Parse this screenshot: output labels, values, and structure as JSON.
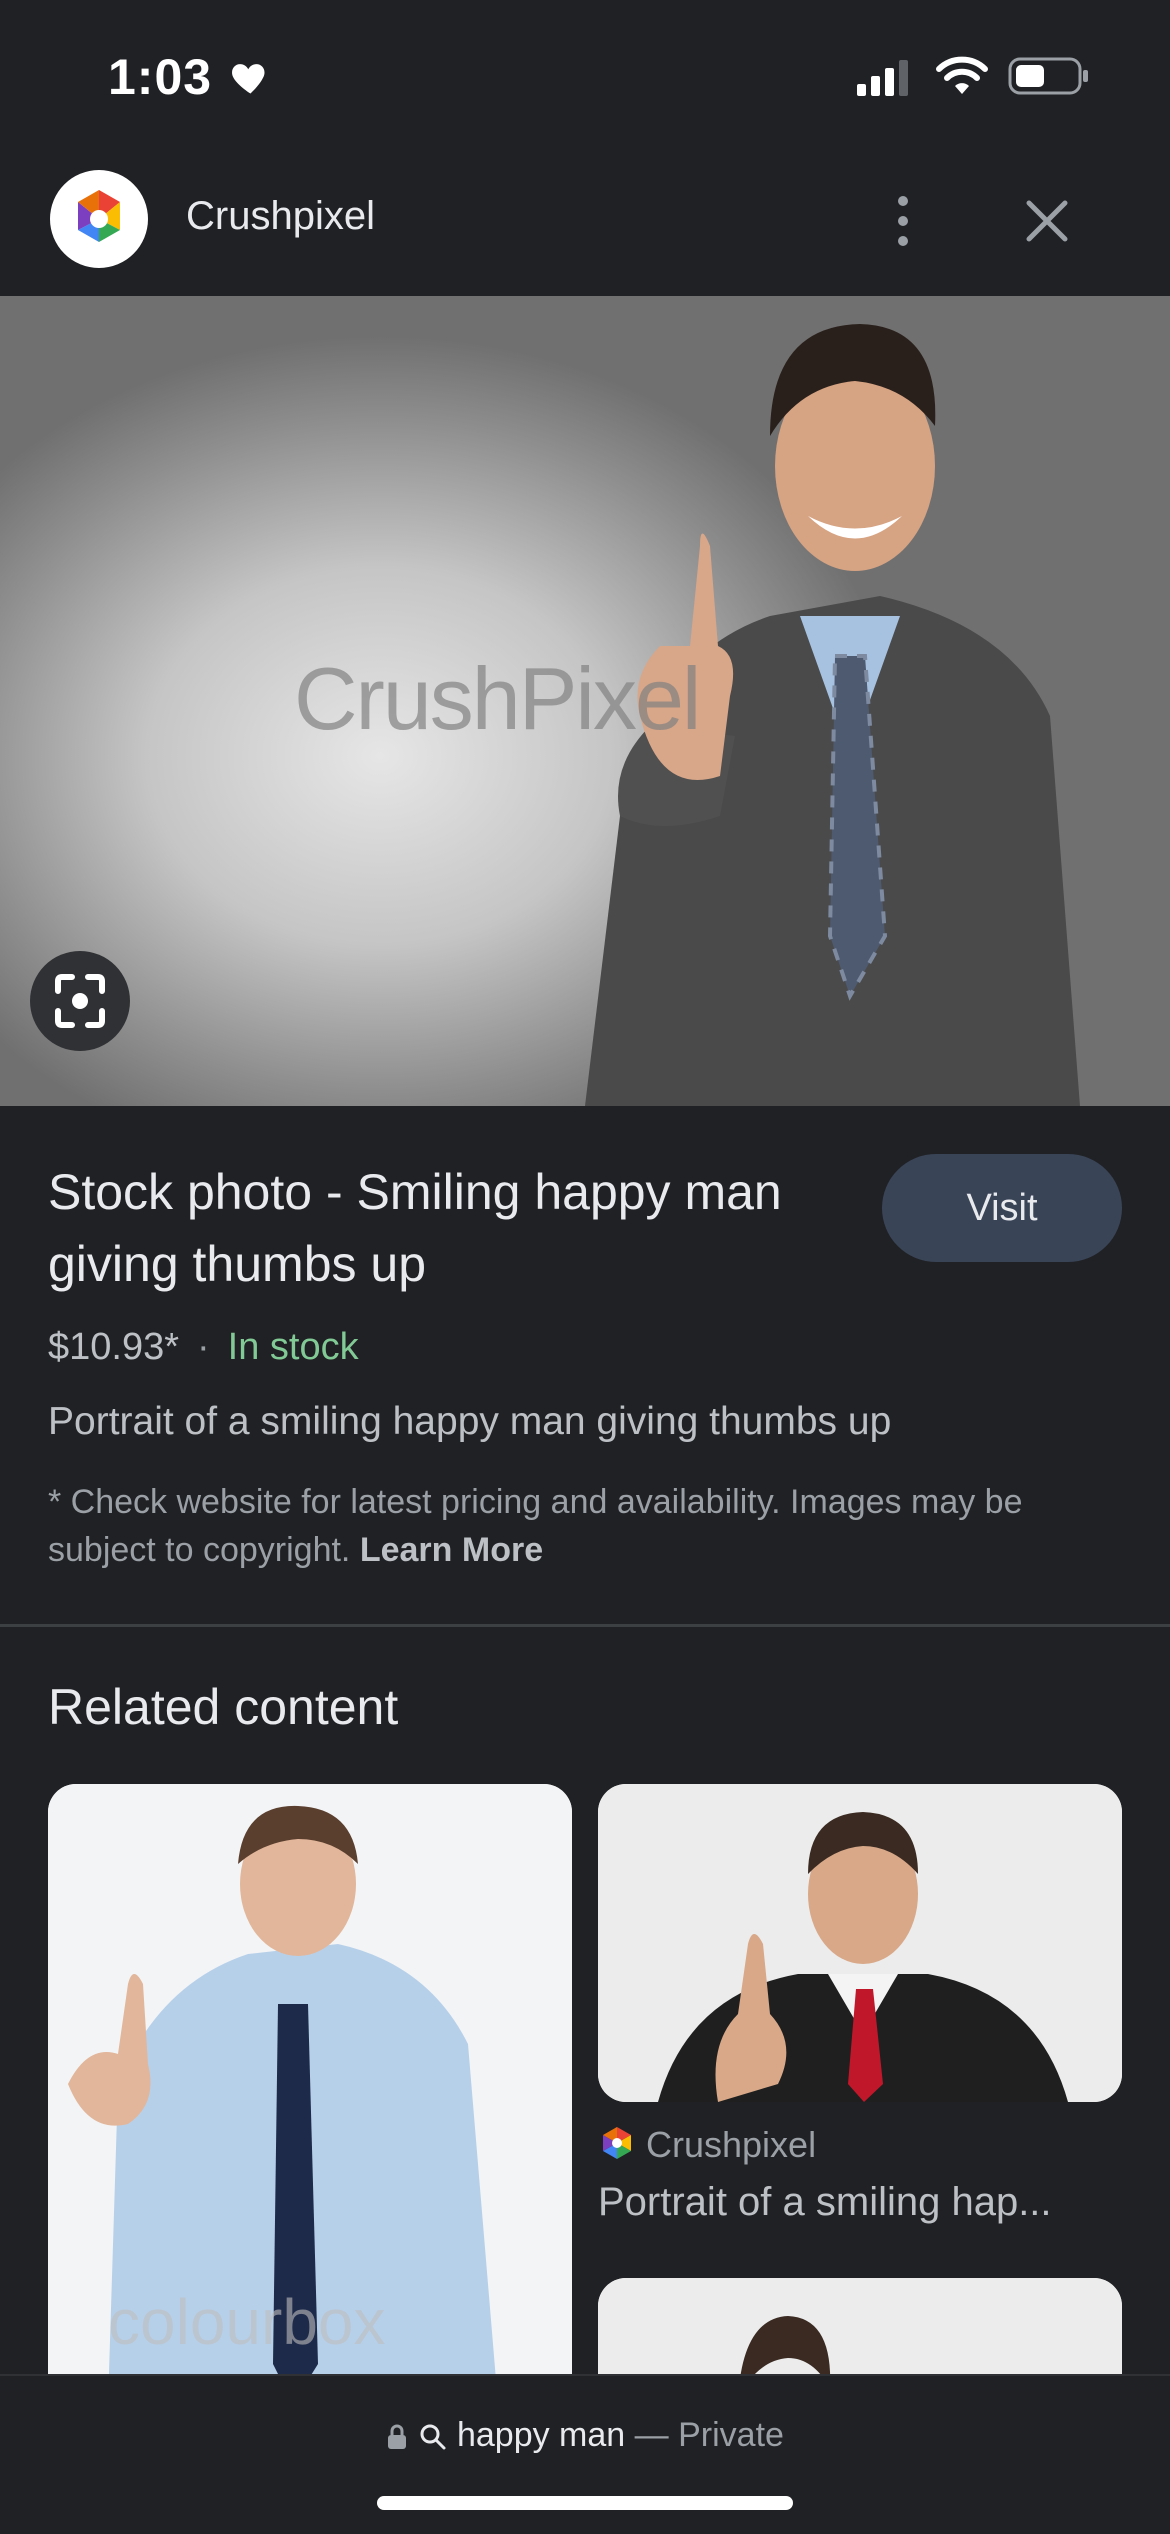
{
  "status_bar": {
    "time": "1:03",
    "icons": [
      "heart-icon",
      "cellular-signal-icon",
      "wifi-icon",
      "battery-icon"
    ]
  },
  "header": {
    "site_name": "Crushpixel",
    "logo_icon": "crushpixel-logo",
    "more_icon": "more-vertical-icon",
    "close_icon": "close-icon"
  },
  "hero": {
    "watermark": "CrushPixel",
    "lens_icon": "lens-icon"
  },
  "product": {
    "title": "Stock photo - Smiling happy man giving thumbs up",
    "visit_label": "Visit",
    "price": "$10.93*",
    "separator": "·",
    "stock_status": "In stock",
    "description": "Portrait of a smiling happy man giving thumbs up",
    "disclaimer": "* Check website for latest pricing and availability. Images may be subject to copyright.",
    "learn_more": "Learn More"
  },
  "related": {
    "heading": "Related content",
    "cards": [
      {
        "watermark": "colourbox"
      },
      {
        "source": "Crushpixel",
        "title": "Portrait of a smiling hap..."
      }
    ]
  },
  "bottom_bar": {
    "query": "happy man",
    "separator": "—",
    "mode": "Private"
  },
  "colors": {
    "background": "#202124",
    "visit_button": "#394457",
    "in_stock": "#81c995",
    "muted_text": "#9aa0a6"
  }
}
